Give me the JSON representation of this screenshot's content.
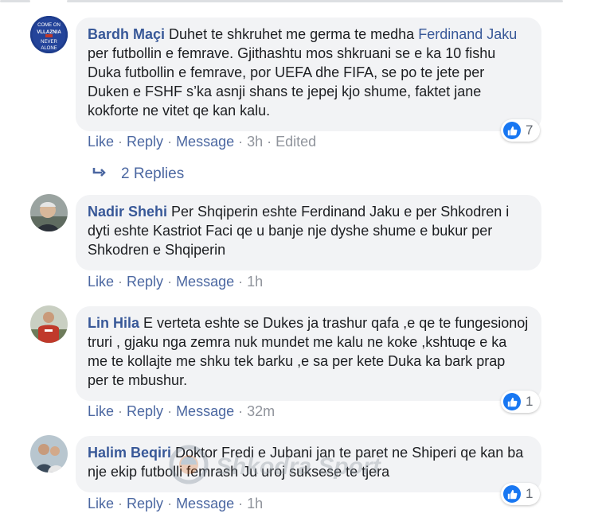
{
  "comments": [
    {
      "author": "Bardh Maçi",
      "text_pre": "Duhet te shkruhet me germa te medha ",
      "mention": "Ferdinand Jaku",
      "text_post": " per futbollin e femrave. Gjithashtu mos shkruani se e ka 10 fishu Duka futbollin e femrave, por UEFA dhe FIFA, se po te jete per Duken e FSHF s’ka asnji shans te jepej kjo shume, faktet jane kokforte ne vitet qe kan kalu.",
      "time": "3h",
      "edited": "Edited",
      "likes": "7",
      "avatar_text": [
        "COME ON",
        "VLLAZNIA",
        "NEVER",
        "ALONE"
      ]
    },
    {
      "author": "Nadir Shehi",
      "text": "Per Shqiperin eshte Ferdinand Jaku e per Shkodren i dyti eshte Kastriot Faci qe u banje nje dyshe shume e bukur per Shkodren e Shqiperin",
      "time": "1h"
    },
    {
      "author": "Lin Hila",
      "text": "E verteta eshte se Dukes ja trashur qafa ,e qe te fungesionoj truri , gjaku nga zemra nuk mundet me kalu ne koke ,kshtuqe e ka me te kollajte me shku tek barku ,e sa per kete Duka ka bark prap per te mbushur.",
      "time": "32m",
      "likes": "1"
    },
    {
      "author": "Halim Beqiri",
      "text": "Doktor Fredi e Jubani jan te paret ne Shiperi qe kan ba nje ekip futbolli femrash Ju uroj suksese te tjera",
      "time": "1h",
      "likes": "1"
    }
  ],
  "actions": {
    "like": "Like",
    "reply": "Reply",
    "message": "Message",
    "dot": "·"
  },
  "replies_label": "2 Replies",
  "watermark": "Shkodra Sport",
  "colors": {
    "link": "#385898",
    "action": "#4b67a1",
    "bubble": "#f2f3f5",
    "like": "#1877f2"
  }
}
